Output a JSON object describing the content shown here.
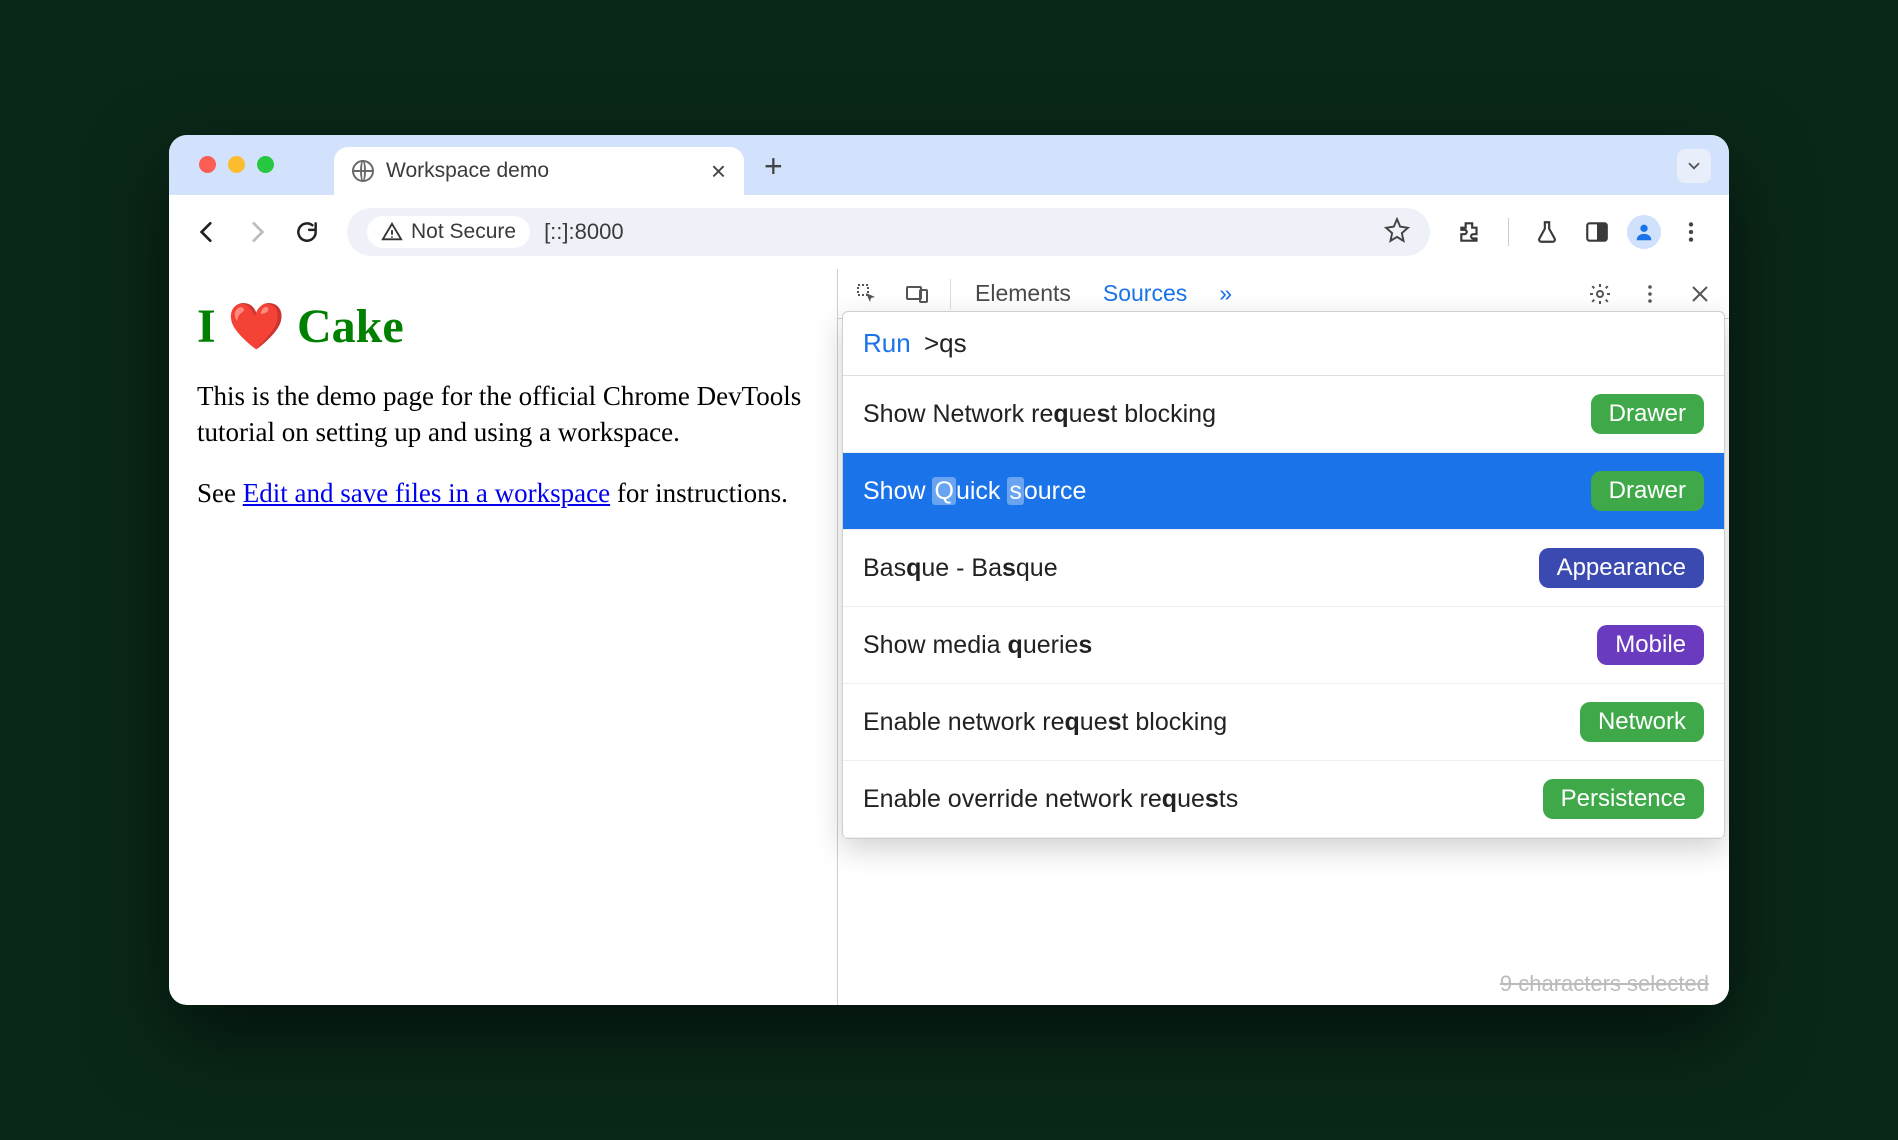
{
  "browser": {
    "tab_title": "Workspace demo",
    "security_label": "Not Secure",
    "url": "[::]:8000"
  },
  "page": {
    "h1_prefix": "I",
    "h1_suffix": "Cake",
    "p1": "This is the demo page for the official Chrome DevTools tutorial on setting up and using a workspace.",
    "p2_prefix": "See ",
    "p2_link": "Edit and save files in a workspace",
    "p2_suffix": " for instructions."
  },
  "devtools": {
    "tabs": {
      "elements": "Elements",
      "sources": "Sources",
      "more": "»"
    },
    "cmd_prefix": "Run",
    "cmd_input": ">qs",
    "items": [
      {
        "pre": "Show Network re",
        "m1": "q",
        "mid": "ue",
        "m2": "s",
        "post": "t blocking",
        "badge": "Drawer",
        "bclass": "b-drawer",
        "sel": false
      },
      {
        "pre": "Show ",
        "m1": "Q",
        "mid": "uick ",
        "m2": "s",
        "post": "ource",
        "badge": "Drawer",
        "bclass": "b-drawer",
        "sel": true
      },
      {
        "pre": "Bas",
        "m1": "q",
        "mid": "ue - Ba",
        "m2": "s",
        "post": "que",
        "badge": "Appearance",
        "bclass": "b-appearance",
        "sel": false
      },
      {
        "pre": "Show media ",
        "m1": "q",
        "mid": "uerie",
        "m2": "s",
        "post": "",
        "badge": "Mobile",
        "bclass": "b-mobile",
        "sel": false
      },
      {
        "pre": "Enable network re",
        "m1": "q",
        "mid": "ue",
        "m2": "s",
        "post": "t blocking",
        "badge": "Network",
        "bclass": "b-network",
        "sel": false
      },
      {
        "pre": "Enable override network re",
        "m1": "q",
        "mid": "ue",
        "m2": "s",
        "post": "ts",
        "badge": "Persistence",
        "bclass": "b-persistence",
        "sel": false
      }
    ],
    "status": "9 characters selected"
  }
}
